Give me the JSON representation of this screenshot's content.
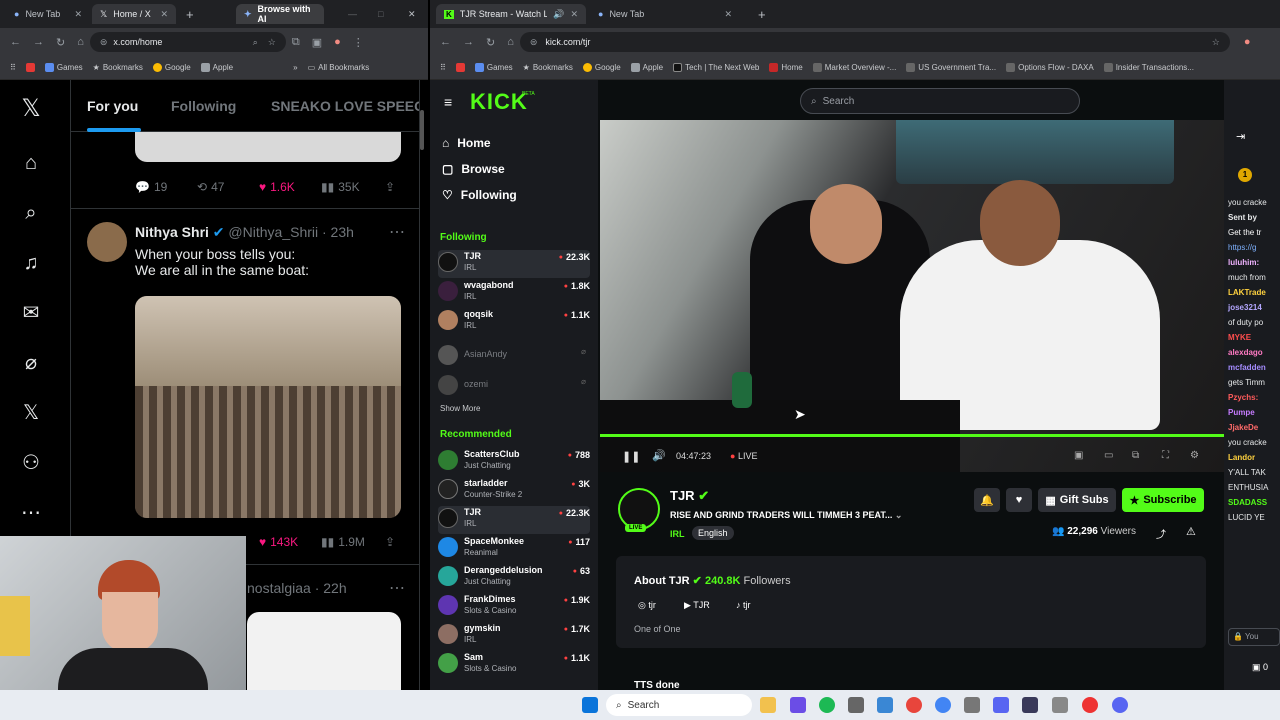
{
  "left_browser": {
    "tabs": [
      {
        "title": "New Tab"
      },
      {
        "title": "Home / X"
      }
    ],
    "ai_button": "Browse with AI",
    "url": "x.com/home",
    "bookmarks": [
      "Games",
      "Bookmarks",
      "Google",
      "Apple"
    ],
    "all_bookmarks": "All Bookmarks"
  },
  "right_browser": {
    "tabs": [
      {
        "title": "TJR Stream - Watch Live on"
      },
      {
        "title": "New Tab"
      }
    ],
    "url": "kick.com/tjr",
    "bookmarks": [
      "Games",
      "Bookmarks",
      "Google",
      "Apple",
      "Tech | The Next Web",
      "Home",
      "Market Overview -...",
      "US Government Tra...",
      "Options Flow - DAXA",
      "Insider Transactions..."
    ]
  },
  "x": {
    "tabs": [
      "For you",
      "Following",
      "SNEAKO LOVE SPEEC"
    ],
    "post1_stats": {
      "replies": "19",
      "reposts": "47",
      "likes": "1.6K",
      "views": "35K"
    },
    "post2": {
      "name": "Nithya Shri",
      "handle": "@Nithya_Shrii",
      "time": "· 23h",
      "text_line1": "When your boss tells you:",
      "text_line2": "We are all in the same boat:",
      "likes": "143K",
      "views": "1.9M"
    },
    "post3_partial": "nostalgiaa · 22h"
  },
  "kick": {
    "logo": "KICK",
    "logo_beta": "BETA",
    "search_placeholder": "Search",
    "nav": [
      "Home",
      "Browse",
      "Following"
    ],
    "following_heading": "Following",
    "following": [
      {
        "name": "TJR",
        "cat": "IRL",
        "viewers": "22.3K",
        "live": true
      },
      {
        "name": "wvagabond",
        "cat": "IRL",
        "viewers": "1.8K",
        "live": true
      },
      {
        "name": "qoqsik",
        "cat": "IRL",
        "viewers": "1.1K",
        "live": true
      },
      {
        "name": "AsianAndy",
        "cat": "",
        "viewers": "",
        "live": false
      },
      {
        "name": "ozemi",
        "cat": "",
        "viewers": "",
        "live": false
      }
    ],
    "show_more": "Show More",
    "recommended_heading": "Recommended",
    "recommended": [
      {
        "name": "ScattersClub",
        "cat": "Just Chatting",
        "viewers": "788"
      },
      {
        "name": "starladder",
        "cat": "Counter-Strike 2",
        "viewers": "3K"
      },
      {
        "name": "TJR",
        "cat": "IRL",
        "viewers": "22.3K"
      },
      {
        "name": "SpaceMonkee",
        "cat": "Reanimal",
        "viewers": "117"
      },
      {
        "name": "Derangeddelusion",
        "cat": "Just Chatting",
        "viewers": "63"
      },
      {
        "name": "FrankDimes",
        "cat": "Slots & Casino",
        "viewers": "1.9K"
      },
      {
        "name": "gymskin",
        "cat": "IRL",
        "viewers": "1.7K"
      },
      {
        "name": "Sam",
        "cat": "Slots & Casino",
        "viewers": "1.1K"
      }
    ],
    "player": {
      "time": "04:47:23",
      "live": "LIVE"
    },
    "stream": {
      "channel": "TJR",
      "live_badge": "LIVE",
      "title": "RISE AND GRIND TRADERS WILL TIMMEH 3 PEAT...",
      "category": "IRL",
      "tag": "English",
      "gift": "Gift Subs",
      "subscribe": "Subscribe",
      "viewers": "22,296",
      "viewers_label": "Viewers"
    },
    "about": {
      "heading": "About TJR",
      "followers": "240.8K",
      "followers_label": "Followers",
      "socials": [
        "tjr",
        "TJR",
        "tjr"
      ],
      "bio": "One of One",
      "tts": "TTS done"
    },
    "chat": [
      {
        "user": "",
        "msg": "you cracke",
        "color": "#e7e9ea"
      },
      {
        "user": "Sent by",
        "msg": "",
        "color": "#e7e9ea"
      },
      {
        "user": "",
        "msg": "Get the tr",
        "color": "#fff"
      },
      {
        "user": "",
        "msg": "https://g",
        "color": "#7fb2ff"
      },
      {
        "user": "luluhim:",
        "msg": "",
        "color": "#f0b3ff"
      },
      {
        "user": "",
        "msg": "much from",
        "color": "#e7e9ea"
      },
      {
        "user": "LAKTrade",
        "msg": "",
        "color": "#ffd23f"
      },
      {
        "user": "jose3214",
        "msg": "",
        "color": "#b4a7ff"
      },
      {
        "user": "",
        "msg": "of duty po",
        "color": "#e7e9ea"
      },
      {
        "user": "MYKE",
        "msg": "",
        "color": "#ff4d4d"
      },
      {
        "user": "alexdago",
        "msg": "",
        "color": "#ff7ac3"
      },
      {
        "user": "mcfadden",
        "msg": "",
        "color": "#a58cff"
      },
      {
        "user": "",
        "msg": "gets Timm",
        "color": "#e7e9ea"
      },
      {
        "user": "Pzychs:",
        "msg": "",
        "color": "#ff5b5b"
      },
      {
        "user": "Pumpe",
        "msg": "",
        "color": "#c67cff"
      },
      {
        "user": "JjakeDe",
        "msg": "",
        "color": "#ff6a6a"
      },
      {
        "user": "",
        "msg": "you cracke",
        "color": "#e7e9ea"
      },
      {
        "user": "Landor",
        "msg": "",
        "color": "#ffd23f"
      },
      {
        "user": "",
        "msg": "Y'ALL TAK",
        "color": "#e7e9ea"
      },
      {
        "user": "",
        "msg": "ENTHUSIA",
        "color": "#e7e9ea"
      },
      {
        "user": "SDADASS",
        "msg": "",
        "color": "#53fc18"
      },
      {
        "user": "",
        "msg": "LUCID YE",
        "color": "#e7e9ea"
      }
    ],
    "chat_input": "You",
    "chat_count": "0"
  },
  "taskbar": {
    "search": "Search"
  }
}
